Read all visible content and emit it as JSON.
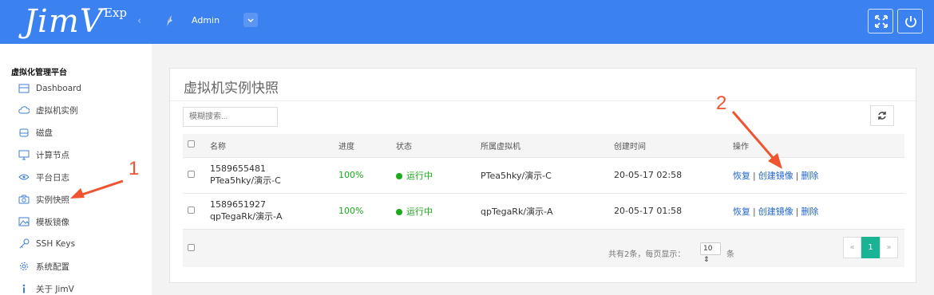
{
  "header": {
    "logo": "JimV",
    "logo_sup": "Exp",
    "collapse_glyph": "‹",
    "user": "Admin",
    "buttons": [
      "fullscreen-icon",
      "power-icon"
    ],
    "accent": "#3b82f0"
  },
  "sidebar": {
    "title": "虚拟化管理平台",
    "items": [
      {
        "label": "Dashboard",
        "icon": "dashboard-icon"
      },
      {
        "label": "虚拟机实例",
        "icon": "cloud-icon"
      },
      {
        "label": "磁盘",
        "icon": "disk-icon"
      },
      {
        "label": "计算节点",
        "icon": "monitor-icon"
      },
      {
        "label": "平台日志",
        "icon": "eye-icon"
      },
      {
        "label": "实例快照",
        "icon": "camera-icon"
      },
      {
        "label": "模板镜像",
        "icon": "image-icon"
      },
      {
        "label": "SSH Keys",
        "icon": "key-icon"
      },
      {
        "label": "系统配置",
        "icon": "gear-icon"
      },
      {
        "label": "关于 JimV",
        "icon": "info-icon"
      }
    ]
  },
  "main": {
    "title": "虚拟机实例快照",
    "search_placeholder": "模糊搜索...",
    "columns": [
      "名称",
      "进度",
      "状态",
      "所属虚拟机",
      "创建时间",
      "操作"
    ],
    "rows": [
      {
        "id": "1589655481",
        "name": "PTea5hky/演示-C",
        "progress": "100%",
        "status": "运行中",
        "vm": "PTea5hky/演示-C",
        "created": "20-05-17 02:58"
      },
      {
        "id": "1589651927",
        "name": "qpTegaRk/演示-A",
        "progress": "100%",
        "status": "运行中",
        "vm": "qpTegaRk/演示-A",
        "created": "20-05-17 01:58"
      }
    ],
    "actions": [
      "恢复",
      "创建镜像",
      "删除"
    ],
    "action_sep": "|",
    "pager": {
      "summary": "共有2条，每页显示：",
      "per_page": "10",
      "unit": "条",
      "prev": "«",
      "current": "1",
      "next": "»"
    },
    "status_color": "#1aaa1a"
  },
  "annotations": {
    "one": "1",
    "two": "2",
    "color": "#f0532f"
  }
}
